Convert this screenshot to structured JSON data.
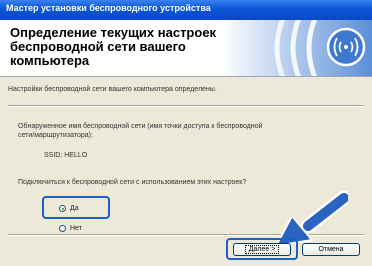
{
  "window": {
    "title": "Мастер установки беспроводного устройства"
  },
  "header": {
    "title": "Определение текущих настроек беспроводной сети вашего компьютера"
  },
  "body": {
    "detected": "Настройки беспроводной сети вашего компьютера определены.",
    "found_line1": "Обнаруженное имя беспроводной сети (имя точки доступа к беспроводной",
    "found_line2": "сети/маршрутизатора):",
    "ssid": "SSID:   HELLO",
    "question": "Подключиться к беспроводной сети с использованием этих настроек?"
  },
  "radios": [
    {
      "label": "Да",
      "selected": true
    },
    {
      "label": "Нет",
      "selected": false
    }
  ],
  "buttons": {
    "next": "Далее >",
    "cancel": "Отмена"
  },
  "colors": {
    "title_bar": "#0a54d8",
    "highlight": "#1a62c8",
    "arrow": "#2a64c0"
  }
}
